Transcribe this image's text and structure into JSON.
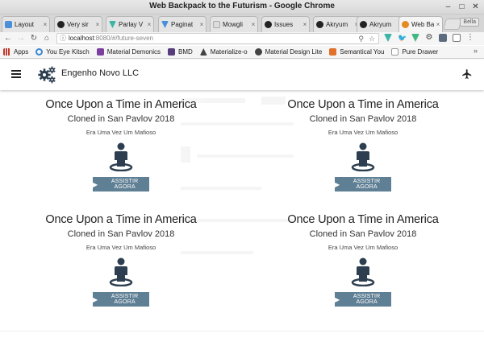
{
  "window": {
    "title": "Web Backpack to the Futurism - Google Chrome"
  },
  "tabs": [
    {
      "label": "Layout",
      "color": "#4a90d9"
    },
    {
      "label": "Very sir",
      "color": "#222222"
    },
    {
      "label": "Parlay V",
      "color": "#3db5a6"
    },
    {
      "label": "Paginat",
      "color": "#4a90d9"
    },
    {
      "label": "Mowgli",
      "color": "#cccccc"
    },
    {
      "label": "Issues",
      "color": "#222222"
    },
    {
      "label": "Akryum",
      "color": "#222222"
    },
    {
      "label": "Akryum",
      "color": "#222222"
    },
    {
      "label": "Web Ba",
      "color": "#e58a1f"
    }
  ],
  "user_badge": "Bella",
  "address": {
    "host": "localhost",
    "path": ":8080/#/future-seven"
  },
  "bookmarks": [
    {
      "label": "Apps",
      "color": "#777777"
    },
    {
      "label": "You Eye Kitsch",
      "color": "#3b88d8"
    },
    {
      "label": "Material Demonics",
      "color": "#7b3fa0"
    },
    {
      "label": "BMD",
      "color": "#563d7c"
    },
    {
      "label": "Materialize-o",
      "color": "#444444"
    },
    {
      "label": "Material Design Lite",
      "color": "#444444"
    },
    {
      "label": "Semantical You",
      "color": "#e0702a"
    },
    {
      "label": "Pure Drawer",
      "color": "#999999"
    }
  ],
  "app": {
    "brand": "Engenho Novo LLC"
  },
  "movies": [
    {
      "title": "Once Upon a Time in America",
      "subtitle": "Cloned in San Pavlov 2018",
      "original": "Era Uma Vez Um Mafioso",
      "button": "ASSISTIR AGORA"
    },
    {
      "title": "Once Upon a Time in America",
      "subtitle": "Cloned in San Pavlov 2018",
      "original": "Era Uma Vez Um Mafioso",
      "button": "ASSISTIR AGORA"
    },
    {
      "title": "Once Upon a Time in America",
      "subtitle": "Cloned in San Pavlov 2018",
      "original": "Era Uma Vez Um Mafioso",
      "button": "ASSISTIR AGORA"
    },
    {
      "title": "Once Upon a Time in America",
      "subtitle": "Cloned in San Pavlov 2018",
      "original": "Era Uma Vez Um Mafioso",
      "button": "ASSISTIR AGORA"
    }
  ],
  "colors": {
    "accent": "#5f7f94",
    "icon": "#2c3e50"
  }
}
